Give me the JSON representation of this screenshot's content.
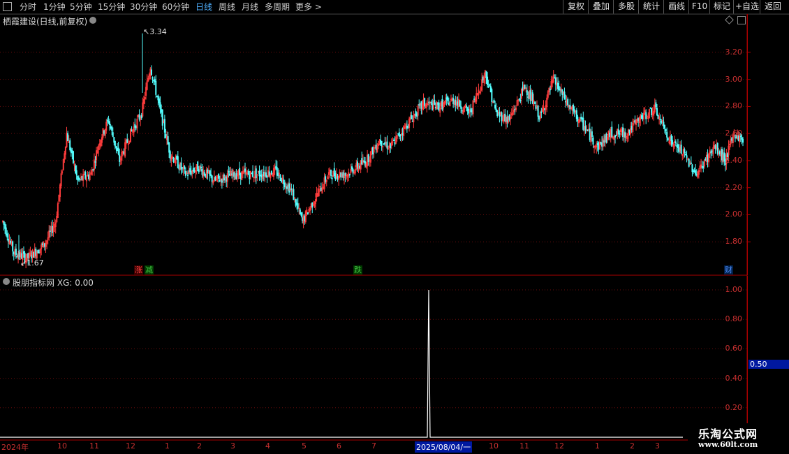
{
  "toolbar": {
    "periods": [
      "分时",
      "1分钟",
      "5分钟",
      "15分钟",
      "30分钟",
      "60分钟",
      "日线",
      "周线",
      "月线",
      "多周期",
      "更多 >"
    ],
    "active_period": "日线",
    "buttons": [
      "复权",
      "叠加",
      "多股",
      "统计",
      "画线",
      "F10",
      "标记",
      "+自选",
      "返回"
    ]
  },
  "main_title": "栖霞建设(日线,前复权)",
  "indicator_title": "股朋指标网 XG: 0.00",
  "annotations": {
    "high": "3.34",
    "low": "1.67"
  },
  "event_tags": [
    {
      "text": "涨",
      "color": "#ff4040"
    },
    {
      "text": "减",
      "color": "#40c040"
    },
    {
      "text": "跌",
      "color": "#40c040"
    },
    {
      "text": "财",
      "color": "#4f8fff"
    }
  ],
  "price_axis": {
    "ticks": [
      "3.20",
      "3.00",
      "2.80",
      "2.60",
      "2.40",
      "2.20",
      "2.00",
      "1.80"
    ]
  },
  "indicator_axis": {
    "ticks": [
      "1.00",
      "0.80",
      "0.60",
      "0.40",
      "0.20"
    ],
    "highlight": "0.50"
  },
  "x_axis": {
    "labels": [
      "2024年",
      "10",
      "11",
      "12",
      "1",
      "2",
      "3",
      "4",
      "5",
      "6",
      "7",
      "2025/08/04/一",
      "10",
      "11",
      "12",
      "1",
      "2",
      "3"
    ]
  },
  "watermark": {
    "line1": "乐淘公式网",
    "line2": "www.60lt.com"
  },
  "colors": {
    "up": "#ff3c3c",
    "down": "#54ffff",
    "axis": "#aa0000",
    "grid": "#7a1010"
  },
  "chart_data": {
    "type": "candlestick",
    "title": "栖霞建设(日线,前复权)",
    "ylim": [
      1.6,
      3.38
    ],
    "high_mark": 3.34,
    "low_mark": 1.67,
    "anchors": [
      [
        0,
        1.95
      ],
      [
        10,
        1.72
      ],
      [
        22,
        1.68
      ],
      [
        38,
        1.78
      ],
      [
        48,
        1.95
      ],
      [
        58,
        2.6
      ],
      [
        68,
        2.25
      ],
      [
        80,
        2.3
      ],
      [
        88,
        2.55
      ],
      [
        96,
        2.7
      ],
      [
        106,
        2.4
      ],
      [
        116,
        2.6
      ],
      [
        126,
        2.75
      ],
      [
        134,
        3.1
      ],
      [
        142,
        2.8
      ],
      [
        152,
        2.45
      ],
      [
        166,
        2.3
      ],
      [
        178,
        2.35
      ],
      [
        192,
        2.25
      ],
      [
        210,
        2.3
      ],
      [
        230,
        2.3
      ],
      [
        248,
        2.32
      ],
      [
        262,
        2.18
      ],
      [
        272,
        1.95
      ],
      [
        282,
        2.1
      ],
      [
        296,
        2.3
      ],
      [
        312,
        2.3
      ],
      [
        330,
        2.4
      ],
      [
        342,
        2.55
      ],
      [
        352,
        2.5
      ],
      [
        370,
        2.7
      ],
      [
        382,
        2.82
      ],
      [
        396,
        2.8
      ],
      [
        410,
        2.85
      ],
      [
        424,
        2.75
      ],
      [
        438,
        3.05
      ],
      [
        448,
        2.75
      ],
      [
        460,
        2.7
      ],
      [
        474,
        2.95
      ],
      [
        488,
        2.72
      ],
      [
        500,
        3.0
      ],
      [
        514,
        2.8
      ],
      [
        528,
        2.65
      ],
      [
        540,
        2.5
      ],
      [
        552,
        2.6
      ],
      [
        566,
        2.6
      ],
      [
        580,
        2.72
      ],
      [
        592,
        2.78
      ],
      [
        606,
        2.55
      ],
      [
        618,
        2.45
      ],
      [
        630,
        2.3
      ],
      [
        646,
        2.5
      ],
      [
        656,
        2.4
      ],
      [
        664,
        2.6
      ],
      [
        672,
        2.55
      ]
    ],
    "indicator": {
      "name": "XG",
      "ylim": [
        0,
        1.05
      ],
      "spike_x": "2025/08/04",
      "spike_value": 1.0,
      "current": 0.0
    }
  }
}
